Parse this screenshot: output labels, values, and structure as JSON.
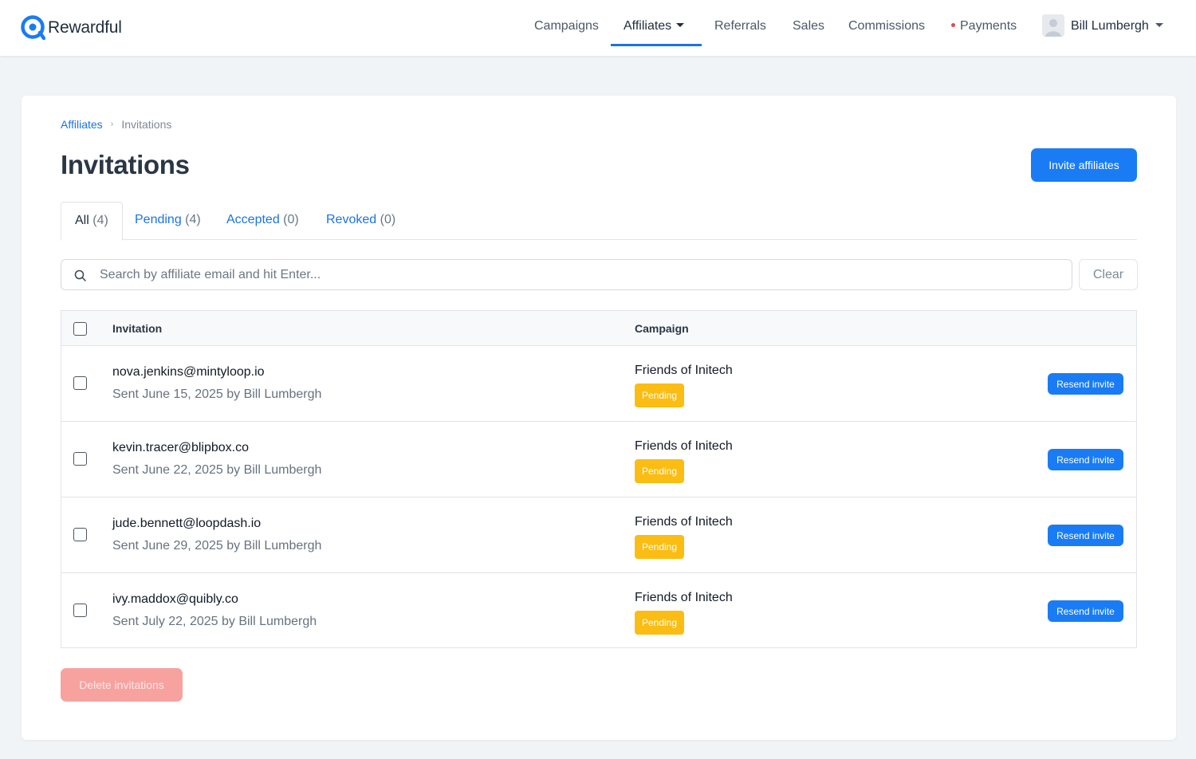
{
  "app": {
    "brand_name": "Rewardful",
    "logo_icon": "rewardful-logo-icon",
    "accent_color": "#1a7cf5"
  },
  "nav": {
    "items": [
      {
        "label": "Campaigns"
      },
      {
        "label": "Affiliates",
        "active": true,
        "has_dropdown": true
      },
      {
        "label": "Referrals"
      },
      {
        "label": "Sales"
      },
      {
        "label": "Commissions"
      },
      {
        "label": "Payments",
        "notification_dot_color": "#f0424b"
      }
    ],
    "user": {
      "name": "Bill Lumbergh",
      "avatar_icon": "user-avatar-icon"
    }
  },
  "breadcrumb": {
    "parent": "Affiliates",
    "current": "Invitations"
  },
  "page": {
    "title": "Invitations",
    "primary_action": "Invite affiliates"
  },
  "tabs": [
    {
      "label": "All",
      "count": "(4)",
      "active": true
    },
    {
      "label": "Pending",
      "count": "(4)"
    },
    {
      "label": "Accepted",
      "count": "(0)"
    },
    {
      "label": "Revoked",
      "count": "(0)"
    }
  ],
  "search": {
    "placeholder": "Search by affiliate email and hit Enter...",
    "value": "",
    "clear_label": "Clear"
  },
  "table": {
    "columns": [
      "Invitation",
      "Campaign"
    ],
    "rows": [
      {
        "email": "nova.jenkins@mintyloop.io",
        "sent": "Sent June 15, 2025 by Bill Lumbergh",
        "campaign": "Friends of Initech",
        "status": "Pending",
        "action": "Resend invite"
      },
      {
        "email": "kevin.tracer@blipbox.co",
        "sent": "Sent June 22, 2025 by Bill Lumbergh",
        "campaign": "Friends of Initech",
        "status": "Pending",
        "action": "Resend invite"
      },
      {
        "email": "jude.bennett@loopdash.io",
        "sent": "Sent June 29, 2025 by Bill Lumbergh",
        "campaign": "Friends of Initech",
        "status": "Pending",
        "action": "Resend invite"
      },
      {
        "email": "ivy.maddox@quibly.co",
        "sent": "Sent July 22, 2025 by Bill Lumbergh",
        "campaign": "Friends of Initech",
        "status": "Pending",
        "action": "Resend invite"
      }
    ],
    "status_color": "#fbbd13"
  },
  "footer": {
    "delete_label": "Delete invitations"
  }
}
